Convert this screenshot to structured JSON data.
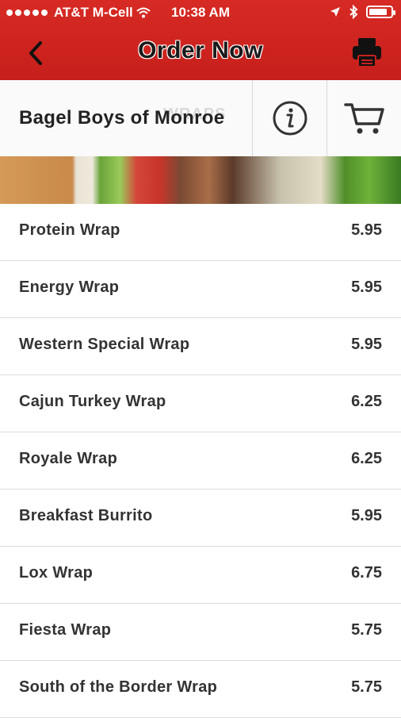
{
  "status_bar": {
    "carrier": "AT&T M-Cell",
    "time": "10:38 AM",
    "battery_level": 0.85
  },
  "nav": {
    "title": "Order Now",
    "back_icon": "chevron-left-icon",
    "print_icon": "printer-icon"
  },
  "restaurant": {
    "name": "Bagel Boys of Monroe",
    "section_watermark": "WRAPS",
    "info_icon": "info-icon",
    "cart_icon": "cart-icon"
  },
  "menu": {
    "items": [
      {
        "name": "Protein Wrap",
        "price": "5.95"
      },
      {
        "name": "Energy Wrap",
        "price": "5.95"
      },
      {
        "name": "Western Special Wrap",
        "price": "5.95"
      },
      {
        "name": "Cajun Turkey Wrap",
        "price": "6.25"
      },
      {
        "name": "Royale Wrap",
        "price": "6.25"
      },
      {
        "name": "Breakfast Burrito",
        "price": "5.95"
      },
      {
        "name": "Lox Wrap",
        "price": "6.75"
      },
      {
        "name": "Fiesta Wrap",
        "price": "5.75"
      },
      {
        "name": "South of the Border Wrap",
        "price": "5.75"
      }
    ]
  },
  "colors": {
    "header_red": "#c8211c",
    "text_dark": "#333333"
  }
}
